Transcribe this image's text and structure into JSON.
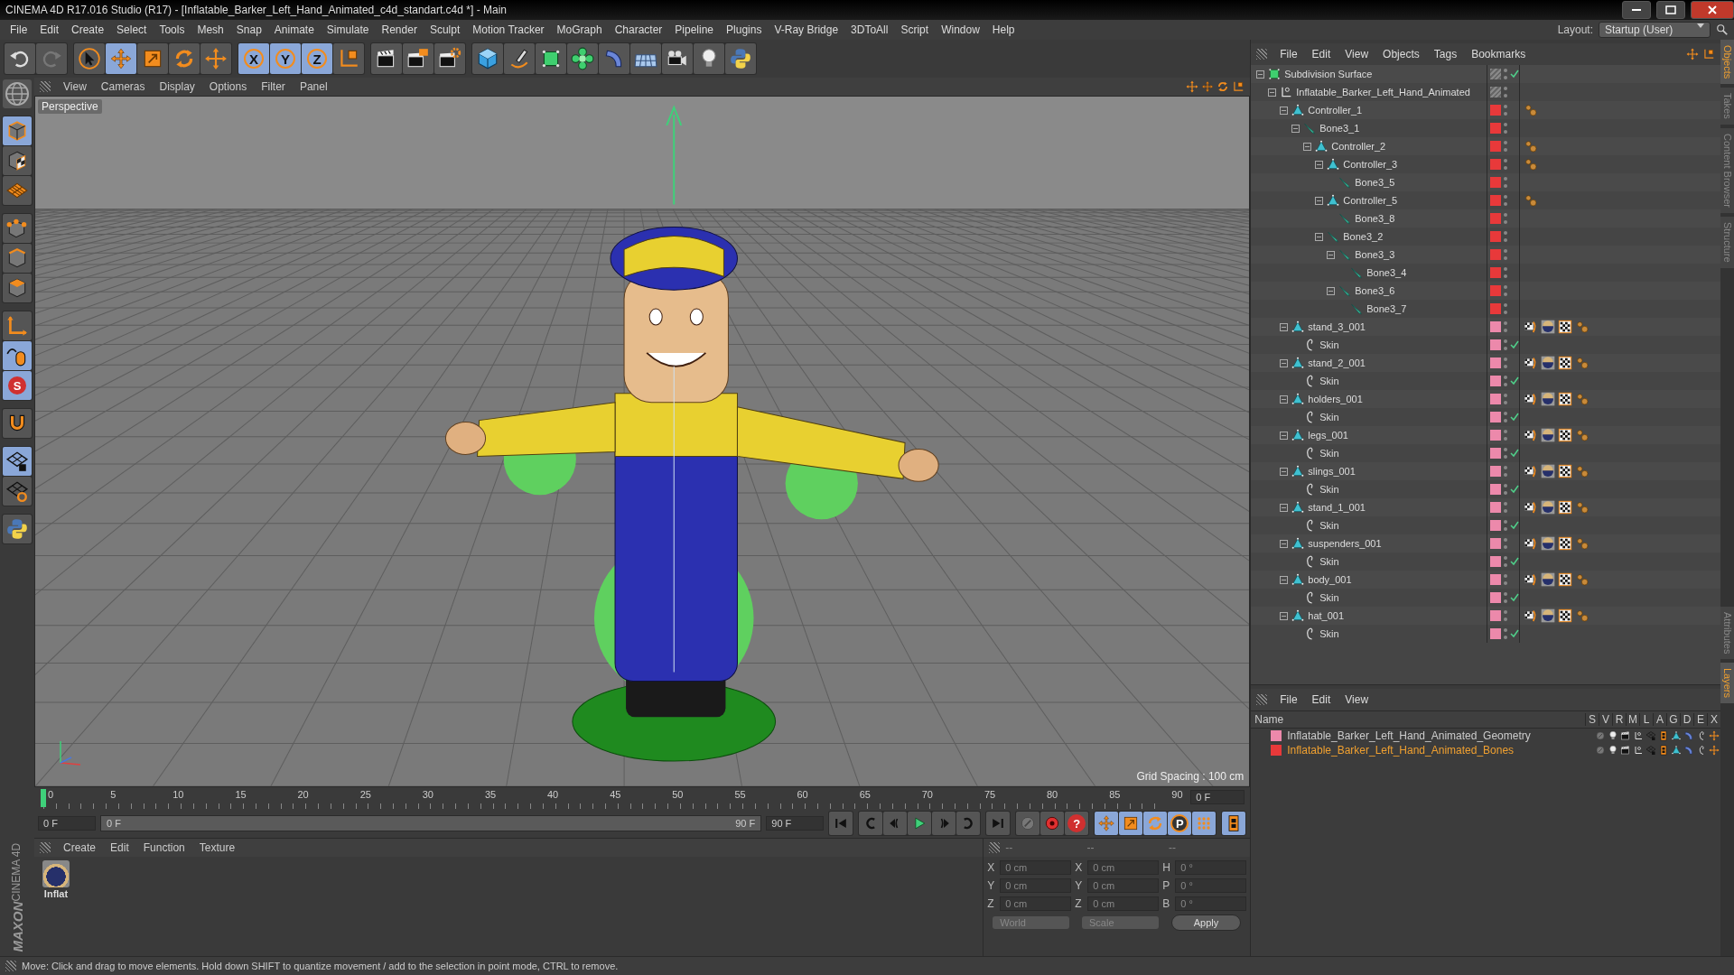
{
  "window": {
    "title": "CINEMA 4D R17.016 Studio (R17) - [Inflatable_Barker_Left_Hand_Animated_c4d_standart.c4d *] - Main"
  },
  "menu": [
    "File",
    "Edit",
    "Create",
    "Select",
    "Tools",
    "Mesh",
    "Snap",
    "Animate",
    "Simulate",
    "Render",
    "Sculpt",
    "Motion Tracker",
    "MoGraph",
    "Character",
    "Pipeline",
    "Plugins",
    "V-Ray Bridge",
    "3DToAll",
    "Script",
    "Window",
    "Help"
  ],
  "layout": {
    "label": "Layout:",
    "value": "Startup (User)"
  },
  "toolbar": [
    [
      {
        "kind": "undo",
        "selected": false
      },
      {
        "kind": "redo",
        "selected": false
      }
    ],
    [
      {
        "kind": "select",
        "selected": false
      },
      {
        "kind": "move",
        "selected": true
      },
      {
        "kind": "scale",
        "selected": false
      },
      {
        "kind": "rotate",
        "selected": false
      },
      {
        "kind": "cross",
        "selected": false
      }
    ],
    [
      {
        "kind": "axis",
        "label": "X",
        "selected": true
      },
      {
        "kind": "axis",
        "label": "Y",
        "selected": true
      },
      {
        "kind": "axis",
        "label": "Z",
        "selected": true
      },
      {
        "kind": "coord",
        "selected": false
      }
    ],
    [
      {
        "kind": "render-view",
        "selected": false
      },
      {
        "kind": "render-picture",
        "selected": false
      },
      {
        "kind": "render-settings",
        "selected": false
      }
    ],
    [
      {
        "kind": "cube",
        "selected": false
      },
      {
        "kind": "pen",
        "selected": false
      },
      {
        "kind": "subdiv",
        "selected": false
      },
      {
        "kind": "cloner",
        "selected": false
      },
      {
        "kind": "deformer",
        "selected": false
      },
      {
        "kind": "floor",
        "selected": false
      },
      {
        "kind": "camera",
        "selected": false
      },
      {
        "kind": "light",
        "selected": false
      },
      {
        "kind": "python",
        "selected": false
      }
    ]
  ],
  "sidebar": [
    [
      {
        "kind": "model",
        "selected": true
      },
      {
        "kind": "texture",
        "selected": false
      },
      {
        "kind": "workplane",
        "selected": false
      }
    ],
    [
      {
        "kind": "points",
        "selected": false
      },
      {
        "kind": "edges",
        "selected": false
      },
      {
        "kind": "polygons",
        "selected": false
      }
    ],
    [
      {
        "kind": "axis-mode",
        "selected": false
      },
      {
        "kind": "tweak",
        "selected": true
      },
      {
        "kind": "snap",
        "label": "S",
        "selected": true
      }
    ],
    [
      {
        "kind": "magnet",
        "selected": false
      }
    ],
    [
      {
        "kind": "grid-lock",
        "selected": true
      },
      {
        "kind": "grid-rotate",
        "selected": false
      }
    ],
    [
      {
        "kind": "python",
        "selected": false
      }
    ]
  ],
  "viewport": {
    "menu": [
      "View",
      "Cameras",
      "Display",
      "Options",
      "Filter",
      "Panel"
    ],
    "camera": "Perspective",
    "grid_spacing": "Grid Spacing : 100 cm"
  },
  "timeline": {
    "ticks": [
      "0",
      "5",
      "10",
      "15",
      "20",
      "25",
      "30",
      "35",
      "40",
      "45",
      "50",
      "55",
      "60",
      "65",
      "70",
      "75",
      "80",
      "85",
      "90"
    ],
    "current": "0 F",
    "start": "0 F",
    "range_start": "0 F",
    "range_end": "90 F",
    "level": 1,
    "end": "90 F",
    "controls": [
      [
        {
          "kind": "first",
          "selected": false
        }
      ],
      [
        {
          "kind": "prev-key",
          "selected": false
        },
        {
          "kind": "prev",
          "selected": false
        },
        {
          "kind": "play",
          "selected": false
        },
        {
          "kind": "next",
          "selected": false
        },
        {
          "kind": "next-key",
          "selected": false
        }
      ],
      [
        {
          "kind": "last",
          "selected": false
        }
      ],
      [
        {
          "kind": "record-off",
          "selected": false
        },
        {
          "kind": "record",
          "selected": false
        },
        {
          "kind": "help",
          "label": "?",
          "selected": false
        }
      ],
      [
        {
          "kind": "move",
          "selected": true
        },
        {
          "kind": "scale",
          "selected": true
        },
        {
          "kind": "rotate",
          "selected": true
        },
        {
          "kind": "param",
          "label": "P",
          "selected": true
        },
        {
          "kind": "dots",
          "selected": true
        }
      ],
      [
        {
          "kind": "film",
          "selected": true
        }
      ]
    ]
  },
  "materials": {
    "menu": [
      "Create",
      "Edit",
      "Function",
      "Texture"
    ],
    "items": [
      {
        "name": "Inflat"
      }
    ]
  },
  "coordinates": {
    "headers": [
      "--",
      "--",
      "--"
    ],
    "rows": [
      {
        "a": "X",
        "position": "0 cm",
        "b": "X",
        "size": "0 cm",
        "c": "H",
        "rotation": "0 °"
      },
      {
        "a": "Y",
        "position": "0 cm",
        "b": "Y",
        "size": "0 cm",
        "c": "P",
        "rotation": "0 °"
      },
      {
        "a": "Z",
        "position": "0 cm",
        "b": "Z",
        "size": "0 cm",
        "c": "B",
        "rotation": "0 °"
      }
    ],
    "mode": "World",
    "size_mode": "Scale",
    "apply": "Apply"
  },
  "logo": {
    "brand": "MAXON",
    "product": "CINEMA 4D"
  },
  "objects": {
    "menu": [
      "File",
      "Edit",
      "View",
      "Objects",
      "Tags",
      "Bookmarks"
    ],
    "tree": [
      {
        "name": "Subdivision Surface",
        "kind": "subdiv",
        "checked": true,
        "children": [
          {
            "name": "Inflatable_Barker_Left_Hand_Animated",
            "kind": "null",
            "checked": false,
            "children": [
              {
                "name": "Controller_1",
                "kind": "joint",
                "color": "#e8393a",
                "checked": false,
                "tags": [
                  {
                    "kind": "ik"
                  }
                ],
                "children": [
                  {
                    "name": "Bone3_1",
                    "kind": "bone",
                    "color": "#e8393a",
                    "checked": false,
                    "children": [
                      {
                        "name": "Controller_2",
                        "kind": "joint",
                        "color": "#e8393a",
                        "checked": false,
                        "tags": [
                          {
                            "kind": "ik"
                          }
                        ],
                        "children": [
                          {
                            "name": "Controller_3",
                            "kind": "joint",
                            "color": "#e8393a",
                            "checked": false,
                            "tags": [
                              {
                                "kind": "ik"
                              }
                            ],
                            "children": [
                              {
                                "name": "Bone3_5",
                                "kind": "bone",
                                "color": "#e8393a",
                                "checked": false
                              }
                            ]
                          },
                          {
                            "name": "Controller_5",
                            "kind": "joint",
                            "color": "#e8393a",
                            "checked": false,
                            "tags": [
                              {
                                "kind": "ik"
                              }
                            ],
                            "children": [
                              {
                                "name": "Bone3_8",
                                "kind": "bone",
                                "color": "#e8393a",
                                "checked": false
                              }
                            ]
                          },
                          {
                            "name": "Bone3_2",
                            "kind": "bone",
                            "color": "#e8393a",
                            "checked": false,
                            "children": [
                              {
                                "name": "Bone3_3",
                                "kind": "bone",
                                "color": "#e8393a",
                                "checked": false,
                                "children": [
                                  {
                                    "name": "Bone3_4",
                                    "kind": "bone",
                                    "color": "#e8393a",
                                    "checked": false
                                  }
                                ]
                              },
                              {
                                "name": "Bone3_6",
                                "kind": "bone",
                                "color": "#e8393a",
                                "checked": false,
                                "children": [
                                  {
                                    "name": "Bone3_7",
                                    "kind": "bone",
                                    "color": "#e8393a",
                                    "checked": false
                                  }
                                ]
                              }
                            ]
                          }
                        ]
                      }
                    ]
                  }
                ]
              },
              {
                "name": "stand_3_001",
                "kind": "joint",
                "color": "#ec89ab",
                "checked": false,
                "tags": [
                  {
                    "kind": "weight"
                  },
                  {
                    "kind": "material"
                  },
                  {
                    "kind": "checker"
                  },
                  {
                    "kind": "ik"
                  }
                ],
                "children": [
                  {
                    "name": "Skin",
                    "kind": "skin",
                    "color": "#ec89ab",
                    "checked": true
                  }
                ]
              },
              {
                "name": "stand_2_001",
                "kind": "joint",
                "color": "#ec89ab",
                "checked": false,
                "tags": [
                  {
                    "kind": "weight"
                  },
                  {
                    "kind": "material"
                  },
                  {
                    "kind": "checker"
                  },
                  {
                    "kind": "ik"
                  }
                ],
                "children": [
                  {
                    "name": "Skin",
                    "kind": "skin",
                    "color": "#ec89ab",
                    "checked": true
                  }
                ]
              },
              {
                "name": "holders_001",
                "kind": "joint",
                "color": "#ec89ab",
                "checked": false,
                "tags": [
                  {
                    "kind": "weight"
                  },
                  {
                    "kind": "material"
                  },
                  {
                    "kind": "checker"
                  },
                  {
                    "kind": "ik"
                  }
                ],
                "children": [
                  {
                    "name": "Skin",
                    "kind": "skin",
                    "color": "#ec89ab",
                    "checked": true
                  }
                ]
              },
              {
                "name": "legs_001",
                "kind": "joint",
                "color": "#ec89ab",
                "checked": false,
                "tags": [
                  {
                    "kind": "weight"
                  },
                  {
                    "kind": "material"
                  },
                  {
                    "kind": "checker"
                  },
                  {
                    "kind": "ik"
                  }
                ],
                "children": [
                  {
                    "name": "Skin",
                    "kind": "skin",
                    "color": "#ec89ab",
                    "checked": true
                  }
                ]
              },
              {
                "name": "slings_001",
                "kind": "joint",
                "color": "#ec89ab",
                "checked": false,
                "tags": [
                  {
                    "kind": "weight"
                  },
                  {
                    "kind": "material"
                  },
                  {
                    "kind": "checker"
                  },
                  {
                    "kind": "ik"
                  }
                ],
                "children": [
                  {
                    "name": "Skin",
                    "kind": "skin",
                    "color": "#ec89ab",
                    "checked": true
                  }
                ]
              },
              {
                "name": "stand_1_001",
                "kind": "joint",
                "color": "#ec89ab",
                "checked": false,
                "tags": [
                  {
                    "kind": "weight"
                  },
                  {
                    "kind": "material"
                  },
                  {
                    "kind": "checker"
                  },
                  {
                    "kind": "ik"
                  }
                ],
                "children": [
                  {
                    "name": "Skin",
                    "kind": "skin",
                    "color": "#ec89ab",
                    "checked": true
                  }
                ]
              },
              {
                "name": "suspenders_001",
                "kind": "joint",
                "color": "#ec89ab",
                "checked": false,
                "tags": [
                  {
                    "kind": "weight"
                  },
                  {
                    "kind": "material"
                  },
                  {
                    "kind": "checker"
                  },
                  {
                    "kind": "ik"
                  }
                ],
                "children": [
                  {
                    "name": "Skin",
                    "kind": "skin",
                    "color": "#ec89ab",
                    "checked": true
                  }
                ]
              },
              {
                "name": "body_001",
                "kind": "joint",
                "color": "#ec89ab",
                "checked": false,
                "tags": [
                  {
                    "kind": "weight"
                  },
                  {
                    "kind": "material"
                  },
                  {
                    "kind": "checker"
                  },
                  {
                    "kind": "ik"
                  }
                ],
                "children": [
                  {
                    "name": "Skin",
                    "kind": "skin",
                    "color": "#ec89ab",
                    "checked": true
                  }
                ]
              },
              {
                "name": "hat_001",
                "kind": "joint",
                "color": "#ec89ab",
                "checked": false,
                "tags": [
                  {
                    "kind": "weight"
                  },
                  {
                    "kind": "material"
                  },
                  {
                    "kind": "checker"
                  },
                  {
                    "kind": "ik"
                  }
                ],
                "children": [
                  {
                    "name": "Skin",
                    "kind": "skin",
                    "color": "#ec89ab",
                    "checked": true
                  }
                ]
              }
            ]
          }
        ]
      }
    ]
  },
  "layers": {
    "menu": [
      "File",
      "Edit",
      "View"
    ],
    "columns": [
      "Name",
      "S",
      "V",
      "R",
      "M",
      "L",
      "A",
      "G",
      "D",
      "E",
      "X"
    ],
    "rows": [
      {
        "name": "Inflatable_Barker_Left_Hand_Animated_Geometry",
        "color": "#ec89ab",
        "selected": false
      },
      {
        "name": "Inflatable_Barker_Left_Hand_Animated_Bones",
        "color": "#e8393a",
        "selected": true
      }
    ]
  },
  "side_tabs": {
    "top": [
      {
        "label": "Objects",
        "selected": true
      },
      {
        "label": "Takes",
        "selected": false
      },
      {
        "label": "Content Browser",
        "selected": false
      },
      {
        "label": "Structure",
        "selected": false
      }
    ],
    "bottom": [
      {
        "label": "Attributes",
        "selected": false
      },
      {
        "label": "Layers",
        "selected": true
      }
    ]
  },
  "status_bar": "Move: Click and drag to move elements. Hold down SHIFT to quantize movement / add to the selection in point mode, CTRL to remove."
}
